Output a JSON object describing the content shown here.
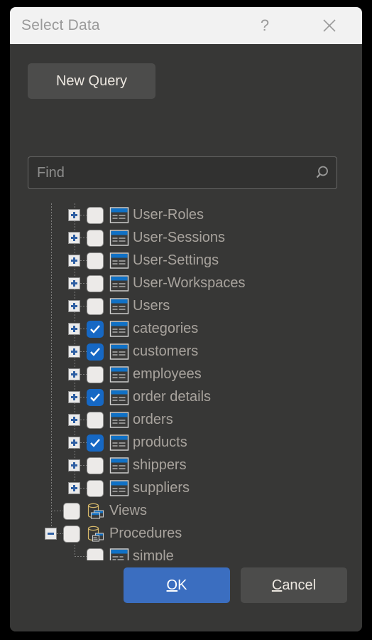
{
  "window": {
    "title": "Select Data",
    "help_icon": "question-mark-icon",
    "close_icon": "close-icon",
    "background_color": "#373736",
    "titlebar_color": "#f2f2f2"
  },
  "toolbar": {
    "new_query_label": "New Query"
  },
  "search": {
    "placeholder": "Find",
    "value": "",
    "icon": "search-icon"
  },
  "tree": {
    "items": [
      {
        "label": "User-Roles",
        "icon": "table-icon",
        "checked": false,
        "expander": "plus",
        "depth": 1
      },
      {
        "label": "User-Sessions",
        "icon": "table-icon",
        "checked": false,
        "expander": "plus",
        "depth": 1
      },
      {
        "label": "User-Settings",
        "icon": "table-icon",
        "checked": false,
        "expander": "plus",
        "depth": 1
      },
      {
        "label": "User-Workspaces",
        "icon": "table-icon",
        "checked": false,
        "expander": "plus",
        "depth": 1
      },
      {
        "label": "Users",
        "icon": "table-icon",
        "checked": false,
        "expander": "plus",
        "depth": 1
      },
      {
        "label": "categories",
        "icon": "table-icon",
        "checked": true,
        "expander": "plus",
        "depth": 1
      },
      {
        "label": "customers",
        "icon": "table-icon",
        "checked": true,
        "expander": "plus",
        "depth": 1
      },
      {
        "label": "employees",
        "icon": "table-icon",
        "checked": false,
        "expander": "plus",
        "depth": 1
      },
      {
        "label": "order details",
        "icon": "table-icon",
        "checked": true,
        "expander": "plus",
        "depth": 1
      },
      {
        "label": "orders",
        "icon": "table-icon",
        "checked": false,
        "expander": "plus",
        "depth": 1
      },
      {
        "label": "products",
        "icon": "table-icon",
        "checked": true,
        "expander": "plus",
        "depth": 1
      },
      {
        "label": "shippers",
        "icon": "table-icon",
        "checked": false,
        "expander": "plus",
        "depth": 1
      },
      {
        "label": "suppliers",
        "icon": "table-icon",
        "checked": false,
        "expander": "plus",
        "depth": 1
      },
      {
        "label": "Views",
        "icon": "views-folder-icon",
        "checked": false,
        "expander": "none",
        "depth": 0
      },
      {
        "label": "Procedures",
        "icon": "procedures-folder-icon",
        "checked": false,
        "expander": "minus",
        "depth": 0
      },
      {
        "label": "simple",
        "icon": "procedure-icon",
        "checked": false,
        "expander": "none",
        "depth": 1
      }
    ]
  },
  "footer": {
    "ok_label": "OK",
    "ok_mnemonic": "O",
    "cancel_label": "Cancel",
    "cancel_mnemonic": "C",
    "ok_color": "#3b6ec0"
  }
}
